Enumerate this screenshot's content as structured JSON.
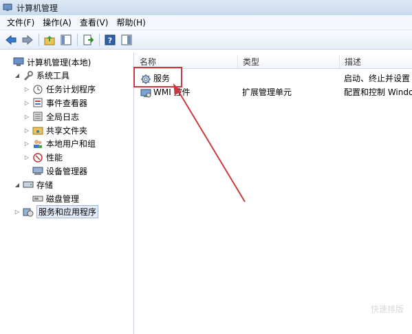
{
  "window": {
    "title": "计算机管理"
  },
  "menu": [
    "文件(F)",
    "操作(A)",
    "查看(V)",
    "帮助(H)"
  ],
  "tree": [
    {
      "label": "计算机管理(本地)",
      "indent": 0,
      "arrow": "",
      "icon": "computer-management-icon"
    },
    {
      "label": "系统工具",
      "indent": 1,
      "arrow": "◢",
      "icon": "tools-icon"
    },
    {
      "label": "任务计划程序",
      "indent": 2,
      "arrow": "▷",
      "icon": "task-scheduler-icon"
    },
    {
      "label": "事件查看器",
      "indent": 2,
      "arrow": "▷",
      "icon": "event-viewer-icon"
    },
    {
      "label": "全局日志",
      "indent": 2,
      "arrow": "▷",
      "icon": "global-log-icon"
    },
    {
      "label": "共享文件夹",
      "indent": 2,
      "arrow": "▷",
      "icon": "shared-folder-icon"
    },
    {
      "label": "本地用户和组",
      "indent": 2,
      "arrow": "▷",
      "icon": "users-icon"
    },
    {
      "label": "性能",
      "indent": 2,
      "arrow": "▷",
      "icon": "performance-icon"
    },
    {
      "label": "设备管理器",
      "indent": 2,
      "arrow": "",
      "icon": "device-manager-icon"
    },
    {
      "label": "存储",
      "indent": 1,
      "arrow": "◢",
      "icon": "storage-icon"
    },
    {
      "label": "磁盘管理",
      "indent": 2,
      "arrow": "",
      "icon": "disk-management-icon"
    },
    {
      "label": "服务和应用程序",
      "indent": 1,
      "arrow": "▷",
      "icon": "services-apps-icon",
      "selected": true
    }
  ],
  "list": {
    "columns": [
      "名称",
      "类型",
      "描述"
    ],
    "rows": [
      {
        "name": "服务",
        "type": "",
        "description": "启动、终止并设置",
        "icon": "services-gear-icon"
      },
      {
        "name": "WMI 控件",
        "type": "扩展管理单元",
        "description": "配置和控制 Windo",
        "icon": "wmi-control-icon"
      }
    ]
  },
  "watermark": "快速排版",
  "colors": {
    "annotation_red": "#c8383c"
  }
}
